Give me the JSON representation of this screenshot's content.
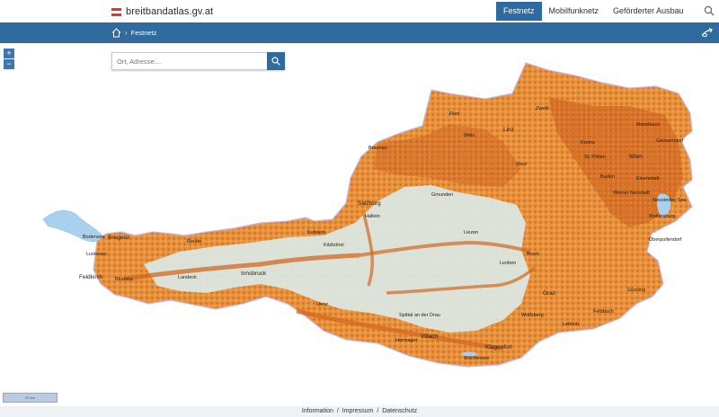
{
  "header": {
    "site_title": "breitbandatlas.gv.at",
    "flag_colors": [
      "#e5332a",
      "#ffffff",
      "#e5332a"
    ],
    "nav": [
      {
        "label": "Festnetz",
        "active": true
      },
      {
        "label": "Mobilfunknetz",
        "active": false
      },
      {
        "label": "Geförderter Ausbau",
        "active": false
      }
    ],
    "search_icon": "search-icon"
  },
  "breadcrumb": {
    "home_icon": "home-icon",
    "separator": "›",
    "current": "Festnetz",
    "right_icon": "share-icon"
  },
  "map_search": {
    "placeholder": "Ort, Adresse....",
    "value": ""
  },
  "zoom": {
    "in_label": "+",
    "out_label": "−"
  },
  "scale": {
    "label": "20 km"
  },
  "footer": {
    "links": [
      "Information",
      "Impressum",
      "Datenschutz"
    ],
    "separator": "/"
  },
  "map": {
    "labels": [
      {
        "name": "Bregenz"
      },
      {
        "name": "Bodensee"
      },
      {
        "name": "Lustenau"
      },
      {
        "name": "Feldkirch"
      },
      {
        "name": "Bludenz"
      },
      {
        "name": "Reutte"
      },
      {
        "name": "Landeck"
      },
      {
        "name": "Innsbruck"
      },
      {
        "name": "Kufstein"
      },
      {
        "name": "Kitzbühel"
      },
      {
        "name": "Lienz"
      },
      {
        "name": "Salzburg"
      },
      {
        "name": "Hallein"
      },
      {
        "name": "Braunau"
      },
      {
        "name": "Ried"
      },
      {
        "name": "Wels"
      },
      {
        "name": "Linz"
      },
      {
        "name": "Steyr"
      },
      {
        "name": "Gmunden"
      },
      {
        "name": "Liezen"
      },
      {
        "name": "Leoben"
      },
      {
        "name": "Bruck"
      },
      {
        "name": "Graz"
      },
      {
        "name": "Spittal an der Drau"
      },
      {
        "name": "Villach"
      },
      {
        "name": "Klagenfurt"
      },
      {
        "name": "Wörthersee"
      },
      {
        "name": "Hermagor"
      },
      {
        "name": "Wolfsberg"
      },
      {
        "name": "Zwettl"
      },
      {
        "name": "Krems"
      },
      {
        "name": "St. Pölten"
      },
      {
        "name": "Wien"
      },
      {
        "name": "Mistelbach"
      },
      {
        "name": "Gänserndorf"
      },
      {
        "name": "Baden"
      },
      {
        "name": "Wiener Neustadt"
      },
      {
        "name": "Eisenstadt"
      },
      {
        "name": "Mattersburg"
      },
      {
        "name": "Oberpullendorf"
      },
      {
        "name": "Güssing"
      },
      {
        "name": "Neusiedler See"
      },
      {
        "name": "Feldbach"
      },
      {
        "name": "Leibnitz"
      }
    ],
    "colors": {
      "coverage_high": "#c8571a",
      "coverage_mid": "#e8913a",
      "coverage_low": "#f4c27e",
      "terrain": "#dbe9e6",
      "water": "#a9d1ee",
      "border": "#c9b7e5"
    }
  }
}
